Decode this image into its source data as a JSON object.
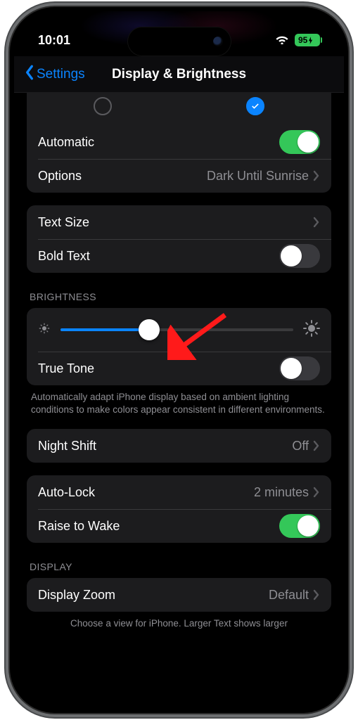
{
  "status": {
    "time": "10:01",
    "battery": "95"
  },
  "nav": {
    "back": "Settings",
    "title": "Display & Brightness"
  },
  "appearance": {
    "automatic_label": "Automatic",
    "automatic_on": true,
    "options_label": "Options",
    "options_value": "Dark Until Sunrise",
    "dark_selected": true
  },
  "text": {
    "text_size_label": "Text Size",
    "bold_label": "Bold Text",
    "bold_on": false
  },
  "brightness": {
    "header": "BRIGHTNESS",
    "value_pct": 38,
    "true_tone_label": "True Tone",
    "true_tone_on": false,
    "footer": "Automatically adapt iPhone display based on ambient lighting conditions to make colors appear consistent in different environments."
  },
  "night_shift": {
    "label": "Night Shift",
    "value": "Off"
  },
  "autolock": {
    "label": "Auto-Lock",
    "value": "2 minutes",
    "raise_label": "Raise to Wake",
    "raise_on": true
  },
  "display": {
    "header": "DISPLAY",
    "zoom_label": "Display Zoom",
    "zoom_value": "Default",
    "footer": "Choose a view for iPhone. Larger Text shows larger"
  }
}
